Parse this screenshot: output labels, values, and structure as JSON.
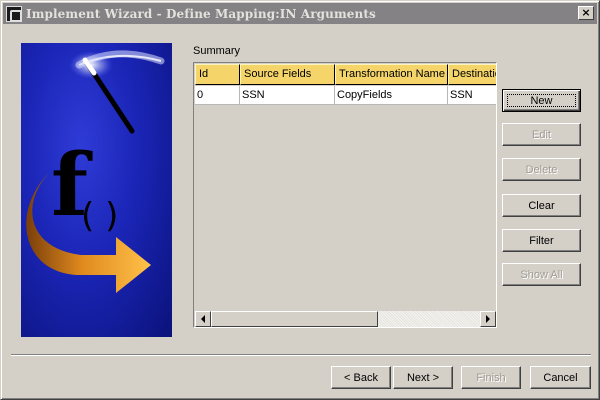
{
  "window": {
    "title": "Implement Wizard - Define Mapping:IN Arguments",
    "close_label": "×"
  },
  "graphic": {
    "letter": "f",
    "parens": "( )"
  },
  "summary": {
    "label": "Summary",
    "columns": [
      "Id",
      "Source Fields",
      "Transformation Name",
      "Destination"
    ],
    "rows": [
      [
        "0",
        "SSN",
        "CopyFields",
        "SSN"
      ]
    ]
  },
  "side_buttons": {
    "new": "New",
    "edit": "Edit",
    "delete": "Delete",
    "clear": "Clear",
    "filter": "Filter",
    "show_all": "Show All"
  },
  "footer_buttons": {
    "back": "< Back",
    "next": "Next >",
    "finish": "Finish",
    "cancel": "Cancel"
  },
  "colors": {
    "header_bg": "#f5d56a",
    "graphic_blue": "#1a25b6",
    "arrow_orange": "#f0a030"
  }
}
